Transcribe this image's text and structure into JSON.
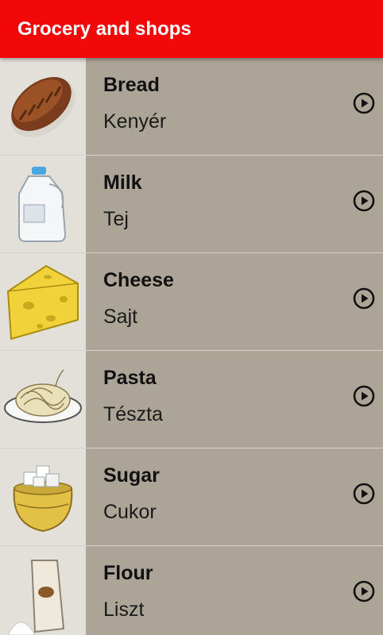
{
  "app_bar": {
    "title": "Grocery and shops",
    "color": "#f20808"
  },
  "list": {
    "items": [
      {
        "name": "Bread",
        "translation": "Kenyér",
        "image": "bread-image",
        "action_icon": "play-circle-icon"
      },
      {
        "name": "Milk",
        "translation": "Tej",
        "image": "milk-jug-image",
        "action_icon": "play-circle-icon"
      },
      {
        "name": "Cheese",
        "translation": "Sajt",
        "image": "cheese-image",
        "action_icon": "play-circle-icon"
      },
      {
        "name": "Pasta",
        "translation": "Tészta",
        "image": "pasta-image",
        "action_icon": "play-circle-icon"
      },
      {
        "name": "Sugar",
        "translation": "Cukor",
        "image": "sugar-bowl-image",
        "action_icon": "play-circle-icon"
      },
      {
        "name": "Flour",
        "translation": "Liszt",
        "image": "flour-bag-image",
        "action_icon": "play-circle-icon"
      }
    ]
  }
}
